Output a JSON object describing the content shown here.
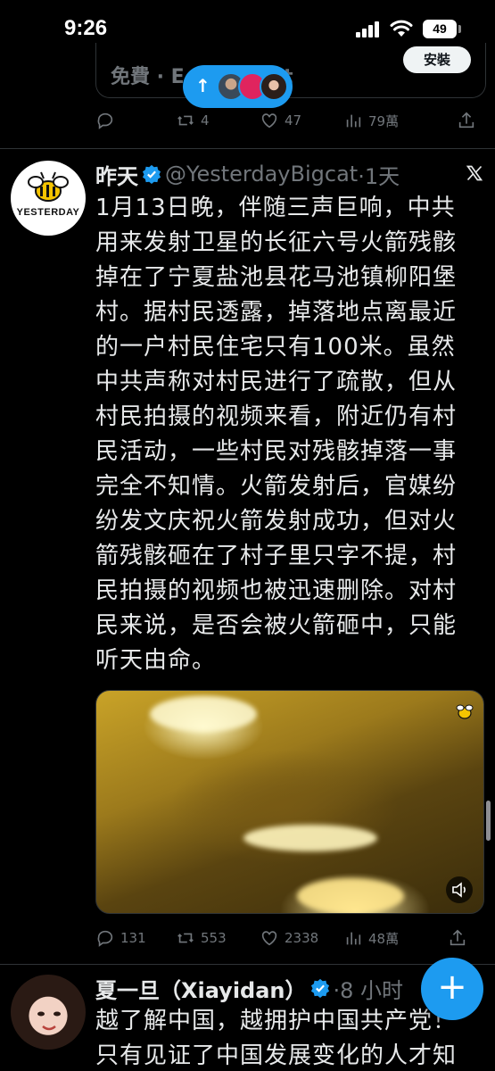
{
  "status_bar": {
    "time": "9:26",
    "battery": "49"
  },
  "prev_tweet": {
    "ad_text": "免費 · E... ...ment",
    "install_label": "安裝",
    "actions": {
      "reply": "",
      "retweet": "4",
      "like": "47",
      "views": "79萬"
    }
  },
  "new_posts_pill": {
    "arrow": "↑"
  },
  "tweet": {
    "display_name": "昨天",
    "handle": "@YesterdayBigcat",
    "time": "·1天",
    "avatar_text": "YESTERDAY",
    "body_lines": [
      "1月13日晚，伴随三声巨响，中共",
      "用来发射卫星的长征六号火箭残骸",
      "掉在了宁夏盐池县花马池镇柳阳堡",
      "村。据村民透露，掉落地点离最近",
      "的一户村民住宅只有100米。虽然",
      "中共声称对村民进行了疏散，但从",
      "村民拍摄的视频来看，附近仍有村",
      "民活动，一些村民对残骸掉落一事",
      "完全不知情。火箭发射后，官媒纷",
      "纷发文庆祝火箭发射成功，但对火",
      "箭残骸砸在了村子里只字不提，村",
      "民拍摄的视频也被迅速删除。对村",
      "民来说，是否会被火箭砸中，只能",
      "听天由命。"
    ],
    "actions": {
      "reply": "131",
      "retweet": "553",
      "like": "2338",
      "views": "48萬"
    }
  },
  "next_tweet": {
    "display_name": "夏一旦（Xiayidan）",
    "time": "·8 小时",
    "body_lines": [
      "越了解中国，越拥护中国共产党！",
      "只有见证了中国发展变化的人才知"
    ]
  },
  "fab": {
    "label": "+"
  },
  "colors": {
    "accent": "#1d9bf0",
    "muted": "#71767b",
    "background": "#000000"
  }
}
